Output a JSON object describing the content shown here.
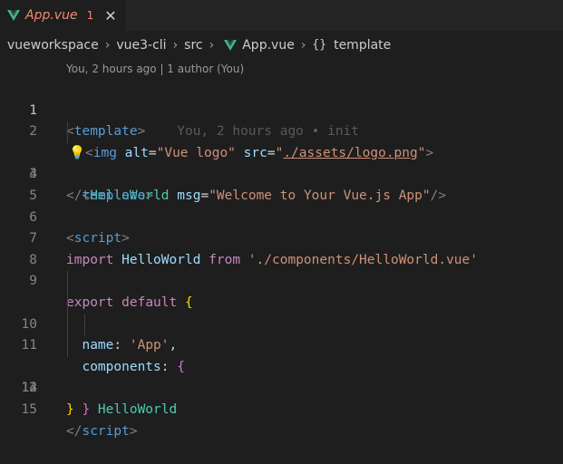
{
  "tab": {
    "filename": "App.vue",
    "badge": "1",
    "close_glyph": "✕"
  },
  "breadcrumb": {
    "items": [
      "vueworkspace",
      "vue3-cli",
      "src",
      "App.vue",
      "template"
    ],
    "separator": "›",
    "braces": "{}"
  },
  "codelens": "You, 2 hours ago | 1 author (You)",
  "lines": [
    {
      "n": "1"
    },
    {
      "n": "2"
    },
    {
      "n": "3"
    },
    {
      "n": "4"
    },
    {
      "n": "5"
    },
    {
      "n": "6"
    },
    {
      "n": "7"
    },
    {
      "n": "8"
    },
    {
      "n": "9"
    },
    {
      "n": "10"
    },
    {
      "n": "11"
    },
    {
      "n": "12"
    },
    {
      "n": "13"
    },
    {
      "n": "14"
    },
    {
      "n": "15"
    }
  ],
  "code": {
    "l1_open": "<",
    "l1_tag": "template",
    "l1_close": ">",
    "l1_blame": "You, 2 hours ago • init",
    "l2_bulb": "💡",
    "l2_open": "<",
    "l2_tag": "img",
    "l2_attr1": "alt",
    "l2_eq1": "=",
    "l2_val1": "\"Vue logo\"",
    "l2_attr2": "src",
    "l2_eq2": "=",
    "l2_q1": "\"",
    "l2_val2": "./assets/logo.png",
    "l2_q2": "\"",
    "l2_close": ">",
    "l3_open": "<",
    "l3_tag": "HelloWorld",
    "l3_attr": "msg",
    "l3_eq": "=",
    "l3_val": "\"Welcome to Your Vue.js App\"",
    "l3_close": "/>",
    "l4_open": "</",
    "l4_tag": "template",
    "l4_close": ">",
    "l6_open": "<",
    "l6_tag": "script",
    "l6_close": ">",
    "l7_kw1": "import",
    "l7_var": "HelloWorld",
    "l7_kw2": "from",
    "l7_str": "'./components/HelloWorld.vue'",
    "l9_kw1": "export",
    "l9_kw2": "default",
    "l9_brace": "{",
    "l10_key": "name",
    "l10_colon": ":",
    "l10_str": "'App'",
    "l10_comma": ",",
    "l11_key": "components",
    "l11_colon": ":",
    "l11_brace": "{",
    "l12_comp": "HelloWorld",
    "l13_brace": "}",
    "l14_brace": "}",
    "l15_open": "</",
    "l15_tag": "script",
    "l15_close": ">"
  },
  "colors": {
    "vue_green": "#41b883",
    "vue_dark": "#35495e",
    "error_red": "#f48771"
  }
}
